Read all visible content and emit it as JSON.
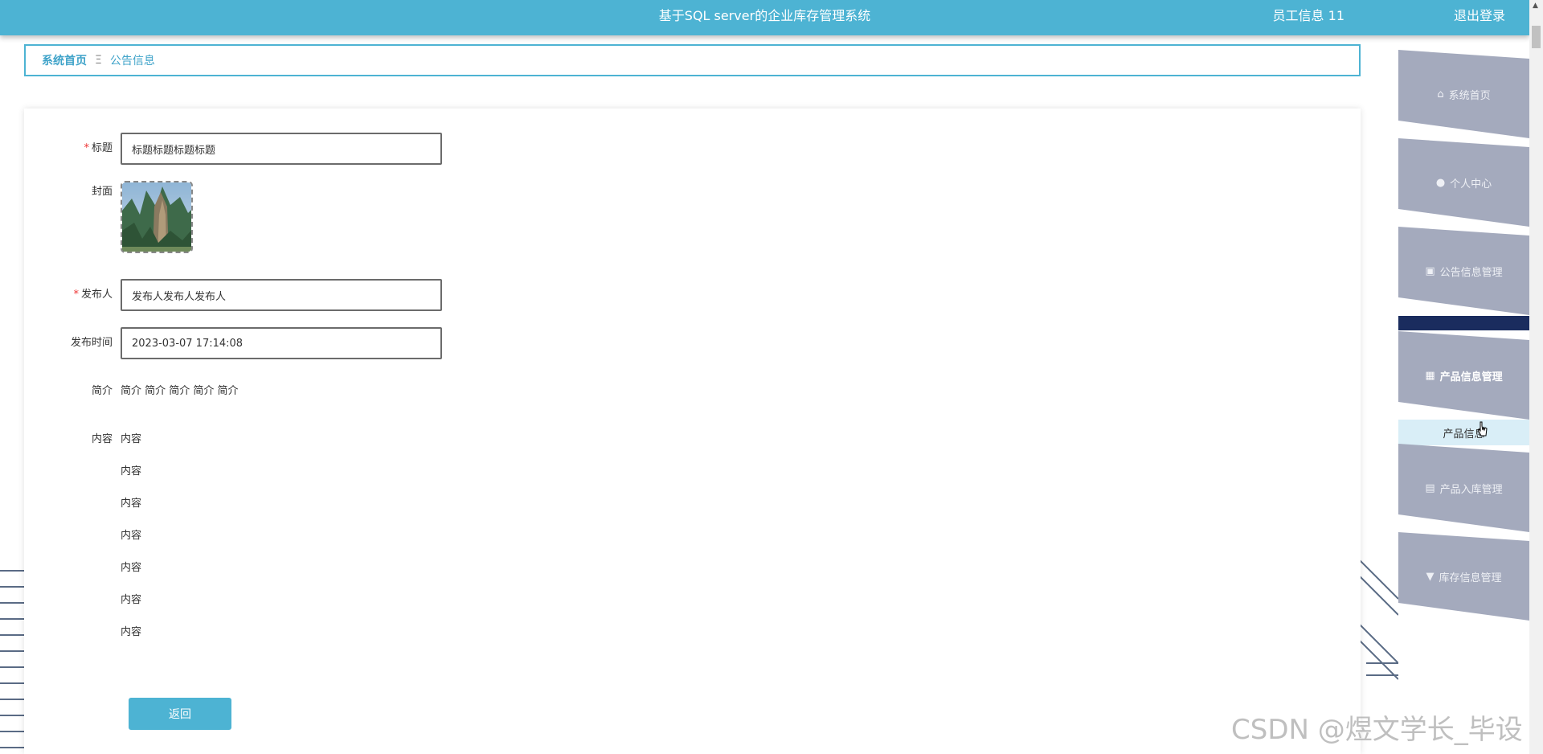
{
  "header": {
    "title": "基于SQL server的企业库存管理系统",
    "user_label": "员工信息 11",
    "logout_label": "退出登录"
  },
  "breadcrumb": {
    "home": "系统首页",
    "separator": "Ξ",
    "current": "公告信息"
  },
  "form": {
    "title_label": "标题",
    "title_value": "标题标题标题标题",
    "cover_label": "封面",
    "publisher_label": "发布人",
    "publisher_value": "发布人发布人发布人",
    "time_label": "发布时间",
    "time_value": "2023-03-07 17:14:08",
    "intro_label": "简介",
    "intro_value": "简介 简介 简介 简介 简介",
    "content_label": "内容",
    "content_lines": [
      "内容",
      "内容",
      "内容",
      "内容",
      "内容",
      "内容",
      "内容"
    ],
    "back_button": "返回"
  },
  "sidebar": {
    "items": [
      {
        "label": "系统首页",
        "icon": "home-icon"
      },
      {
        "label": "个人中心",
        "icon": "user-icon"
      },
      {
        "label": "公告信息管理",
        "icon": "clipboard-icon"
      },
      {
        "label": "产品信息管理",
        "icon": "grid-icon"
      },
      {
        "label": "产品入库管理",
        "icon": "table-icon"
      },
      {
        "label": "库存信息管理",
        "icon": "pin-icon"
      }
    ],
    "submenu_item": "产品信息"
  },
  "watermark": "CSDN @煜文学长_毕设",
  "colors": {
    "accent": "#4db3d3",
    "sidebar_bg": "#a4aabd",
    "sidebar_dark": "#1a2c5e"
  }
}
